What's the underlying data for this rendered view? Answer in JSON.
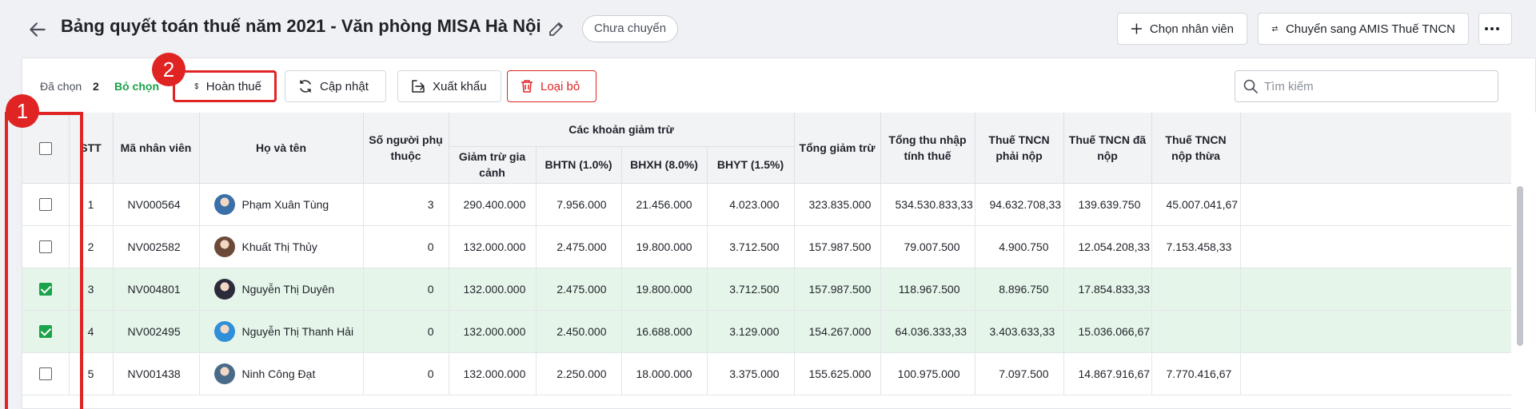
{
  "header": {
    "title": "Bảng quyết toán thuế năm 2021 - Văn phòng MISA Hà Nội",
    "status": "Chưa chuyển",
    "add_employee_label": "Chọn nhân viên",
    "transfer_label": "Chuyển sang AMIS Thuế TNCN"
  },
  "toolbar": {
    "selected_label": "Đã chọn",
    "selected_count": "2",
    "deselect_label": "Bỏ chọn",
    "refund_label": "Hoàn thuế",
    "update_label": "Cập nhật",
    "export_label": "Xuất khẩu",
    "remove_label": "Loại bỏ",
    "search_placeholder": "Tìm kiếm"
  },
  "annotations": {
    "badge1": "1",
    "badge2": "2"
  },
  "table": {
    "headers": {
      "stt": "STT",
      "code": "Mã nhân viên",
      "name": "Họ và tên",
      "dependents": "Số người phụ thuộc",
      "deductions_group": "Các khoản giảm trừ",
      "family": "Giảm trừ gia cảnh",
      "bhtn": "BHTN (1.0%)",
      "bhxh": "BHXH (8.0%)",
      "bhyt": "BHYT (1.5%)",
      "total_deduction": "Tổng giảm trừ",
      "taxable_income": "Tổng thu nhập tính thuế",
      "tax_payable": "Thuế TNCN phải nộp",
      "tax_paid": "Thuế TNCN đã nộp",
      "tax_overpaid": "Thuế TNCN nộp thừa"
    },
    "rows": [
      {
        "selected": false,
        "stt": "1",
        "code": "NV000564",
        "name": "Phạm Xuân Tùng",
        "dependents": "3",
        "family": "290.400.000",
        "bhtn": "7.956.000",
        "bhxh": "21.456.000",
        "bhyt": "4.023.000",
        "total_deduction": "323.835.000",
        "taxable_income": "534.530.833,33",
        "tax_payable": "94.632.708,33",
        "tax_paid": "139.639.750",
        "tax_overpaid": "45.007.041,67",
        "avatar_color": "#3b6fa8"
      },
      {
        "selected": false,
        "stt": "2",
        "code": "NV002582",
        "name": "Khuất Thị Thủy",
        "dependents": "0",
        "family": "132.000.000",
        "bhtn": "2.475.000",
        "bhxh": "19.800.000",
        "bhyt": "3.712.500",
        "total_deduction": "157.987.500",
        "taxable_income": "79.007.500",
        "tax_payable": "4.900.750",
        "tax_paid": "12.054.208,33",
        "tax_overpaid": "7.153.458,33",
        "avatar_color": "#6b4a3a"
      },
      {
        "selected": true,
        "stt": "3",
        "code": "NV004801",
        "name": "Nguyễn Thị Duyên",
        "dependents": "0",
        "family": "132.000.000",
        "bhtn": "2.475.000",
        "bhxh": "19.800.000",
        "bhyt": "3.712.500",
        "total_deduction": "157.987.500",
        "taxable_income": "118.967.500",
        "tax_payable": "8.896.750",
        "tax_paid": "17.854.833,33",
        "tax_overpaid": "",
        "avatar_color": "#2b2b3a"
      },
      {
        "selected": true,
        "stt": "4",
        "code": "NV002495",
        "name": "Nguyễn Thị Thanh Hải",
        "dependents": "0",
        "family": "132.000.000",
        "bhtn": "2.450.000",
        "bhxh": "16.688.000",
        "bhyt": "3.129.000",
        "total_deduction": "154.267.000",
        "taxable_income": "64.036.333,33",
        "tax_payable": "3.403.633,33",
        "tax_paid": "15.036.066,67",
        "tax_overpaid": "",
        "avatar_color": "#2f8fd8"
      },
      {
        "selected": false,
        "stt": "5",
        "code": "NV001438",
        "name": "Ninh Công Đạt",
        "dependents": "0",
        "family": "132.000.000",
        "bhtn": "2.250.000",
        "bhxh": "18.000.000",
        "bhyt": "3.375.000",
        "total_deduction": "155.625.000",
        "taxable_income": "100.975.000",
        "tax_payable": "7.097.500",
        "tax_paid": "14.867.916,67",
        "tax_overpaid": "7.770.416,67",
        "avatar_color": "#4a6a8a"
      }
    ]
  }
}
